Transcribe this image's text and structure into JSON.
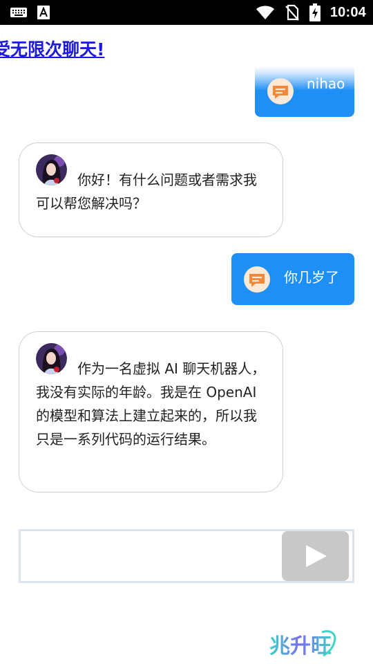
{
  "status_bar": {
    "time": "10:04",
    "left_icons": [
      "keyboard-icon",
      "a-icon"
    ],
    "right_icons": [
      "wifi-icon",
      "no-sim-icon",
      "battery-charging-icon"
    ]
  },
  "marquee": {
    "text": "受无限次聊天!"
  },
  "messages": [
    {
      "role": "user",
      "text": "nihao",
      "icon": "chat-bubble-icon"
    },
    {
      "role": "bot",
      "text": "你好！有什么问题或者需求我可以帮您解决吗？",
      "avatar": "bot-avatar"
    },
    {
      "role": "user",
      "text": "你几岁了",
      "icon": "chat-bubble-icon"
    },
    {
      "role": "bot",
      "text": "作为一名虚拟 AI 聊天机器人，我没有实际的年龄。我是在 OpenAI 的模型和算法上建立起来的，所以我只是一系列代码的运行结果。",
      "avatar": "bot-avatar"
    }
  ],
  "input": {
    "value": "",
    "placeholder": "",
    "send_icon": "play-icon"
  },
  "watermark": {
    "text": "兆升旺"
  },
  "colors": {
    "user_bubble": "#1e8ff5",
    "marquee_text": "#1c1ad6",
    "send_button": "#c8c8c8",
    "icon_orange": "#f08a3a"
  }
}
